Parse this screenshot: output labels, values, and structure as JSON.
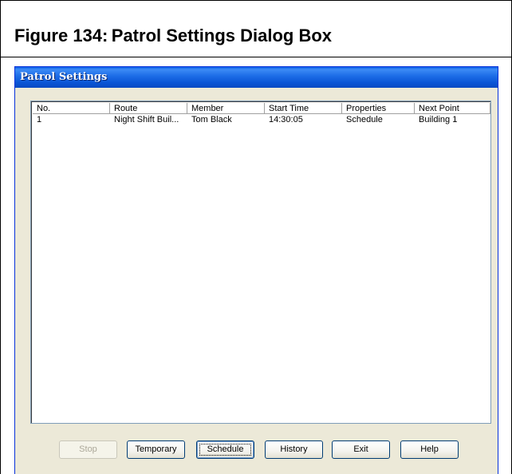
{
  "figure": {
    "title": "Figure 134: Patrol Settings Dialog Box"
  },
  "window": {
    "title": "Patrol Settings"
  },
  "list": {
    "columns": [
      "No.",
      "Route",
      "Member",
      "Start Time",
      "Properties",
      "Next Point"
    ],
    "rows": [
      [
        "1",
        "Night Shift Buil...",
        "Tom Black",
        "14:30:05",
        "Schedule",
        "Building 1"
      ]
    ]
  },
  "buttons": {
    "stop": "Stop",
    "temporary": "Temporary",
    "schedule": "Schedule",
    "history": "History",
    "exit": "Exit",
    "help": "Help"
  },
  "colors": {
    "titlebar": "#0a55d6",
    "dialog_bg": "#ece9d8",
    "disabled_text": "#aca899"
  }
}
